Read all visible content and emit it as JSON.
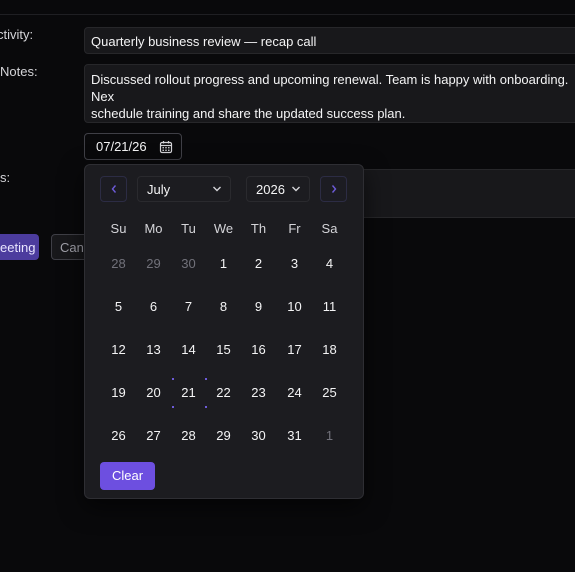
{
  "form": {
    "activity_label": "ctivity:",
    "activity_value": "Quarterly business review — recap call",
    "notes_label": "Notes:",
    "notes_value": "Discussed rollout progress and upcoming renewal. Team is happy with onboarding. Nex\nschedule training and share the updated success plan.",
    "third_label": "s:",
    "date_value": "07/21/26",
    "primary_button": "eeting",
    "secondary_button": "Canc"
  },
  "datepicker": {
    "month": "July",
    "year": "2026",
    "weekdays": [
      "Su",
      "Mo",
      "Tu",
      "We",
      "Th",
      "Fr",
      "Sa"
    ],
    "weeks": [
      [
        "28",
        "29",
        "30",
        "1",
        "2",
        "3",
        "4"
      ],
      [
        "5",
        "6",
        "7",
        "8",
        "9",
        "10",
        "11"
      ],
      [
        "12",
        "13",
        "14",
        "15",
        "16",
        "17",
        "18"
      ],
      [
        "19",
        "20",
        "21",
        "22",
        "23",
        "24",
        "25"
      ],
      [
        "26",
        "27",
        "28",
        "29",
        "30",
        "31",
        "1"
      ]
    ],
    "muted": [
      [
        0,
        0
      ],
      [
        0,
        1
      ],
      [
        0,
        2
      ],
      [
        4,
        6
      ]
    ],
    "selected": [
      3,
      2
    ],
    "clear_label": "Clear"
  },
  "icons": {
    "calendar": "calendar-icon",
    "prev": "chevron-left-icon",
    "next": "chevron-right-icon",
    "dropdown": "chevron-down-icon"
  },
  "colors": {
    "accent": "#6d4fe0",
    "background": "#09090b",
    "popover": "#1c1c20"
  }
}
